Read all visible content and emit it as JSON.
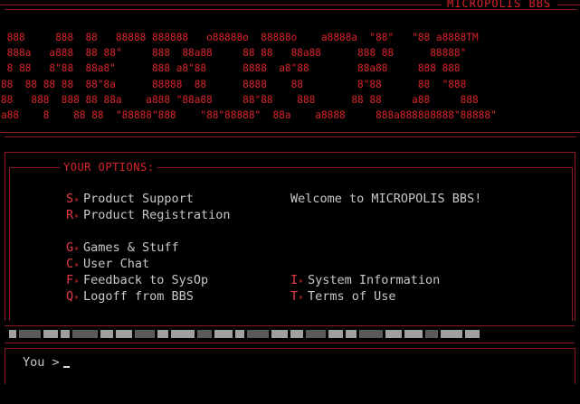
{
  "banner": {
    "title": "MICROPOLIS BBS",
    "ascii_art": " 888     888  88   88888 888888   o88888o  88888o    a8888a  \"88\"   \"88 a8888TM\n 888a   a888  88 88\"     888  88a88     88 88   88a88      888 88      88888\"\n 8 88   8\"88  88a8\"      888 a8\"88      8888  a8\"88        88a88     888 888\n88  88 88 88  88\"8a      88888  88      8888    88         8\"88      88  \"888\n88   888  888 88 88a    a888 \"88a88     88\"88    888      88 88     a88     888\na88    8    88 88  \"88888\"888    \"88\"88888\"  88a    a8888     888a888888888\"88888\""
  },
  "options_title": "YOUR OPTIONS:",
  "menu_left": [
    {
      "key": "S",
      "label": "Product Support"
    },
    {
      "key": "R",
      "label": "Product Registration"
    },
    {
      "key": "G",
      "label": "Games & Stuff"
    },
    {
      "key": "C",
      "label": "User Chat"
    },
    {
      "key": "F",
      "label": "Feedback to SysOp"
    },
    {
      "key": "Q",
      "label": "Logoff from BBS"
    }
  ],
  "welcome": "Welcome to MICROPOLIS BBS!",
  "menu_right": [
    {
      "key": "I",
      "label": "System Information"
    },
    {
      "key": "T",
      "label": "Terms of Use"
    }
  ],
  "prompt": {
    "label": "You >"
  },
  "colors": {
    "accent_red": "#d8232a",
    "key_red": "#e63a4a",
    "text": "#c8c8c8",
    "bar_gray": "#a0a0a0"
  }
}
